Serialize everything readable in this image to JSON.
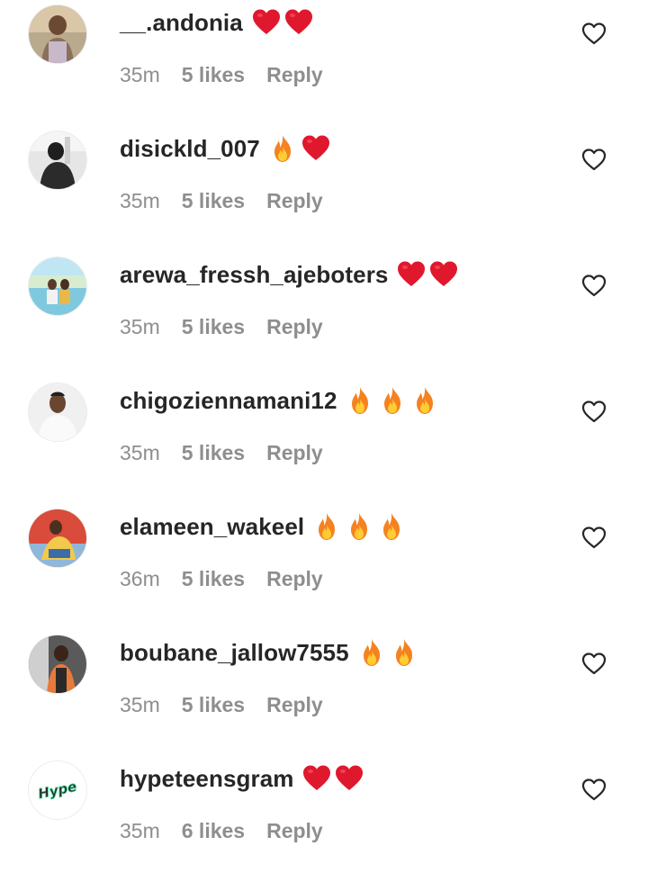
{
  "comments": [
    {
      "username": "__.andonia",
      "emojis": [
        "heart",
        "heart"
      ],
      "time": "35m",
      "likes": "5 likes",
      "reply": "Reply",
      "avatar_icon": "user-avatar-photo"
    },
    {
      "username": "disickld_007",
      "emojis": [
        "fire",
        "heart"
      ],
      "time": "35m",
      "likes": "5 likes",
      "reply": "Reply",
      "avatar_icon": "user-avatar-photo"
    },
    {
      "username": "arewa_fressh_ajeboters",
      "emojis": [
        "heart",
        "heart"
      ],
      "time": "35m",
      "likes": "5 likes",
      "reply": "Reply",
      "avatar_icon": "user-avatar-photo"
    },
    {
      "username": "chigoziennamani12",
      "emojis": [
        "fire",
        "fire",
        "fire"
      ],
      "time": "35m",
      "likes": "5 likes",
      "reply": "Reply",
      "avatar_icon": "user-avatar-photo"
    },
    {
      "username": "elameen_wakeel",
      "emojis": [
        "fire",
        "fire",
        "fire"
      ],
      "time": "36m",
      "likes": "5 likes",
      "reply": "Reply",
      "avatar_icon": "user-avatar-photo"
    },
    {
      "username": "boubane_jallow7555",
      "emojis": [
        "fire",
        "fire"
      ],
      "time": "35m",
      "likes": "5 likes",
      "reply": "Reply",
      "avatar_icon": "user-avatar-photo"
    },
    {
      "username": "hypeteensgram",
      "emojis": [
        "heart",
        "heart"
      ],
      "time": "35m",
      "likes": "6 likes",
      "reply": "Reply",
      "avatar_icon": "hype-logo-avatar",
      "avatar_logo_text": "Hype"
    }
  ],
  "colors": {
    "username": "#262626",
    "meta": "#8e8e8e",
    "heart_emoji": "#e0182e",
    "fire_outer": "#f58220",
    "fire_inner": "#ffcc33",
    "like_icon_stroke": "#262626"
  }
}
